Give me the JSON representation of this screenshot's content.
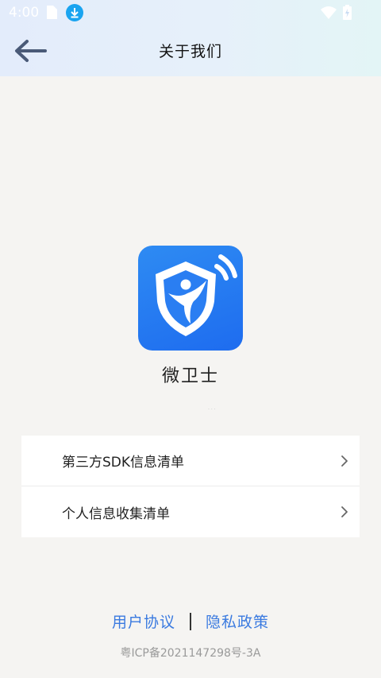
{
  "status_bar": {
    "time": "4:00"
  },
  "header": {
    "title": "关于我们"
  },
  "app": {
    "name": "微卫士",
    "tiny_text": "· · ·",
    "logo_color": "#1f6fef"
  },
  "menu": {
    "items": [
      {
        "label": "第三方SDK信息清单"
      },
      {
        "label": "个人信息收集清单"
      }
    ]
  },
  "footer": {
    "user_agreement": "用户协议",
    "privacy_policy": "隐私政策",
    "icp": "粤ICP备2021147298号-3A"
  },
  "colors": {
    "link": "#3a7ae0",
    "background": "#f5f4f2"
  }
}
